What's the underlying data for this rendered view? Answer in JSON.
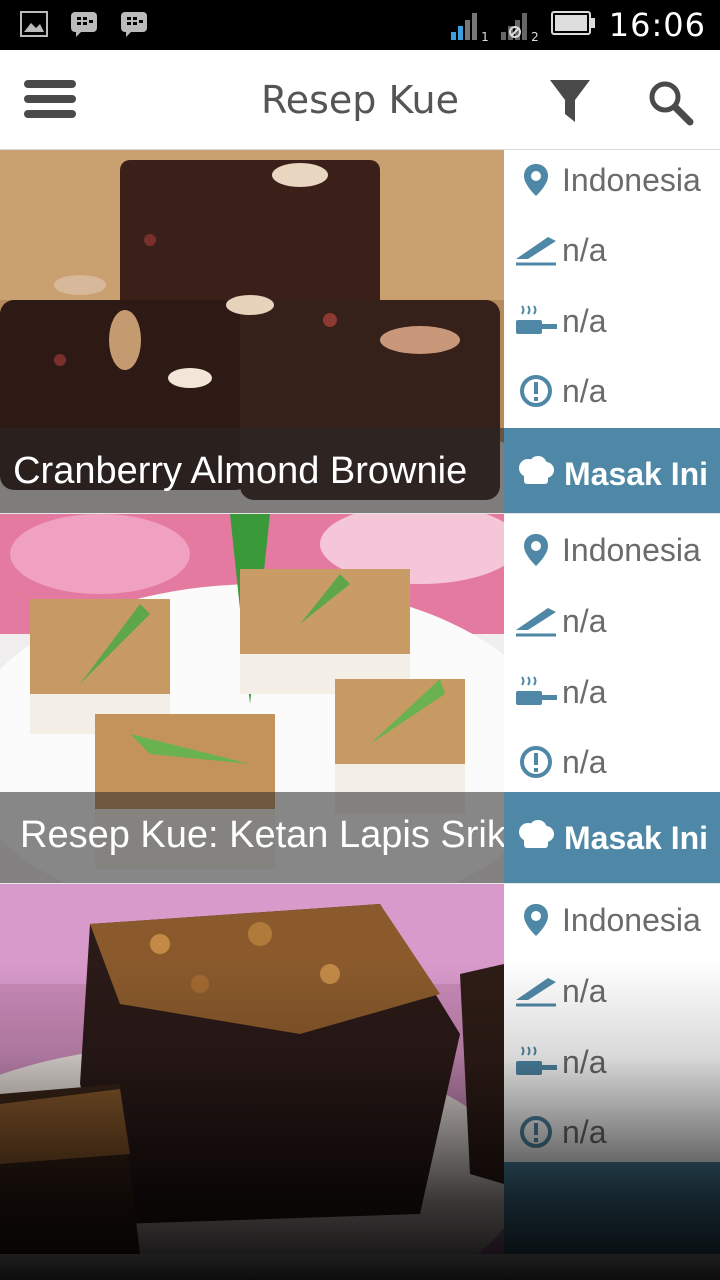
{
  "status_bar": {
    "time": "16:06",
    "sim1": "1",
    "sim2": "2",
    "icons": [
      "image-icon",
      "bbm-icon",
      "bbm-icon",
      "signal-icon",
      "battery-icon"
    ]
  },
  "app_bar": {
    "title": "Resep Kue",
    "menu_icon": "hamburger-menu-icon",
    "filter_icon": "filter-icon",
    "search_icon": "search-icon"
  },
  "colors": {
    "accent": "#4f88a6",
    "icon_blue": "#4f88a6",
    "text_gray": "#6b6b6b"
  },
  "recipes": [
    {
      "caption": ": Cranberry Almond Brownie",
      "origin": "Indonesia",
      "prep": "n/a",
      "cook": "n/a",
      "difficulty": "n/a",
      "button": "Masak Ini"
    },
    {
      "caption": "Resep Kue: Ketan Lapis Srika",
      "origin": "Indonesia",
      "prep": "n/a",
      "cook": "n/a",
      "difficulty": "n/a",
      "button": "Masak Ini"
    },
    {
      "caption": "",
      "origin": "Indonesia",
      "prep": "n/a",
      "cook": "n/a",
      "difficulty": "n/a",
      "button": ""
    }
  ]
}
